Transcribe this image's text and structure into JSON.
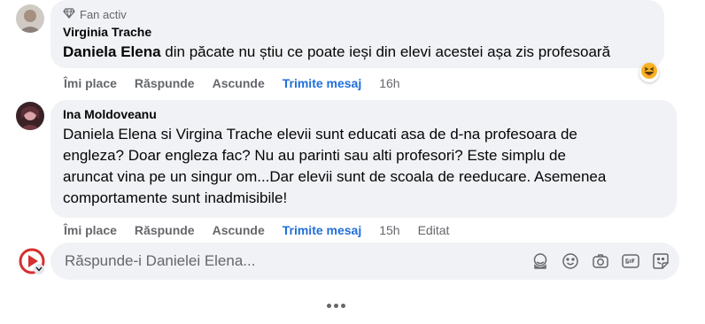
{
  "comments": [
    {
      "badge": "Fan activ",
      "author": "Virginia Trache",
      "mention": "Daniela Elena",
      "text": " din păcate nu știu ce poate ieși din elevi acestei așa zis profesoară",
      "actions": {
        "like": "Îmi place",
        "reply": "Răspunde",
        "hide": "Ascunde",
        "message": "Trimite mesaj",
        "time": "16h"
      },
      "reaction": "haha-emoji-icon"
    },
    {
      "author": "Ina Moldoveanu",
      "lines": [
        "Daniela Elena si Virgina Trache elevii sunt educati asa de d-na profesoara de",
        "engleza? Doar engleza fac? Nu au parinti sau alti profesori? Este simplu de",
        "aruncat vina pe un singur om...Dar elevii sunt de scoala de reeducare. Asemenea",
        "comportamente sunt inadmisibile!"
      ],
      "actions": {
        "like": "Îmi place",
        "reply": "Răspunde",
        "hide": "Ascunde",
        "message": "Trimite mesaj",
        "time": "15h",
        "edited": "Editat"
      }
    }
  ],
  "reply": {
    "placeholder": "Răspunde-i Danielei Elena...",
    "tools": [
      "sticker-face-icon",
      "emoji-icon",
      "camera-icon",
      "gif-icon",
      "sticker-icon"
    ]
  },
  "colors": {
    "bubble": "#f0f2f5",
    "secondary_text": "#65676b",
    "link_blue": "#216fdb"
  }
}
